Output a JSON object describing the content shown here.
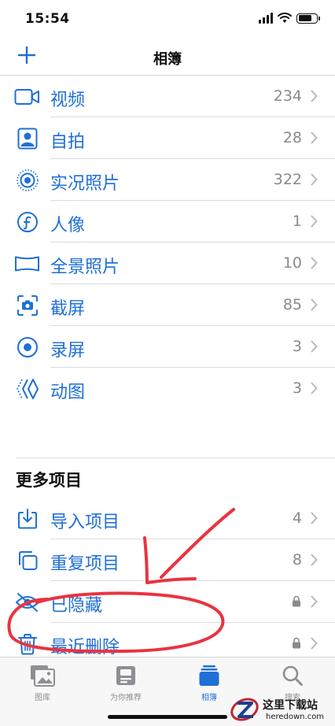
{
  "status": {
    "time": "15:54"
  },
  "nav": {
    "title": "相簿",
    "add_icon": "plus-icon"
  },
  "media_types": [
    {
      "icon": "video-icon",
      "label": "视频",
      "count": "234"
    },
    {
      "icon": "selfie-icon",
      "label": "自拍",
      "count": "28"
    },
    {
      "icon": "live-photo-icon",
      "label": "实况照片",
      "count": "322"
    },
    {
      "icon": "portrait-icon",
      "label": "人像",
      "count": "1"
    },
    {
      "icon": "panorama-icon",
      "label": "全景照片",
      "count": "10"
    },
    {
      "icon": "screenshot-icon",
      "label": "截屏",
      "count": "85"
    },
    {
      "icon": "screen-recording-icon",
      "label": "录屏",
      "count": "3"
    },
    {
      "icon": "animated-icon",
      "label": "动图",
      "count": "3"
    }
  ],
  "more": {
    "title": "更多项目",
    "items": [
      {
        "icon": "import-icon",
        "label": "导入项目",
        "count": "4"
      },
      {
        "icon": "duplicates-icon",
        "label": "重复项目",
        "count": "8"
      },
      {
        "icon": "hidden-icon",
        "label": "已隐藏",
        "locked": true
      },
      {
        "icon": "trash-icon",
        "label": "最近删除",
        "locked": true
      }
    ]
  },
  "tabs": [
    {
      "icon": "photo-library-icon",
      "label": "图库",
      "active": false
    },
    {
      "icon": "for-you-icon",
      "label": "为你推荐",
      "active": false
    },
    {
      "icon": "albums-icon",
      "label": "相簿",
      "active": true
    },
    {
      "icon": "search-icon",
      "label": "搜索",
      "active": false
    }
  ],
  "watermark": {
    "cn": "这里下载站",
    "en": "heredown.com"
  },
  "colors": {
    "accent": "#1f6fd6",
    "annotation": "#e8343f",
    "secondary": "#8a8a8e"
  }
}
